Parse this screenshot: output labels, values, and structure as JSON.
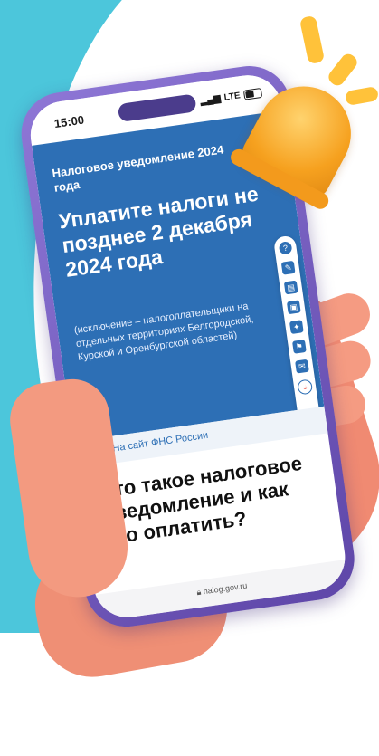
{
  "phone": {
    "status_time": "15:00",
    "status_network": "LTE",
    "hero_tag": "Налоговое уведомление 2024 года",
    "hero_title": "Уплатите налоги не позднее 2 декабря 2024 года",
    "hero_note": "(исключение – налогоплательщики на отдельных территориях Белгородской, Курской и Оренбургской областей)",
    "nav_back_icon": "chevron-left-icon",
    "nav_link": "На сайт ФНС России",
    "article_title": "Что такое налоговое уведомление и как его оплатить?",
    "url": "nalog.gov.ru",
    "sidebar_icons": [
      "question-icon",
      "pencil-icon",
      "clipboard-icon",
      "inbox-icon",
      "pin-icon",
      "flag-icon",
      "mail-icon",
      "logo-icon"
    ]
  },
  "colors": {
    "accent_blue": "#2d6fb5",
    "phone_frame": "#6f58bd",
    "bell": "#f6a11f",
    "background_band": "#4cc6db"
  }
}
